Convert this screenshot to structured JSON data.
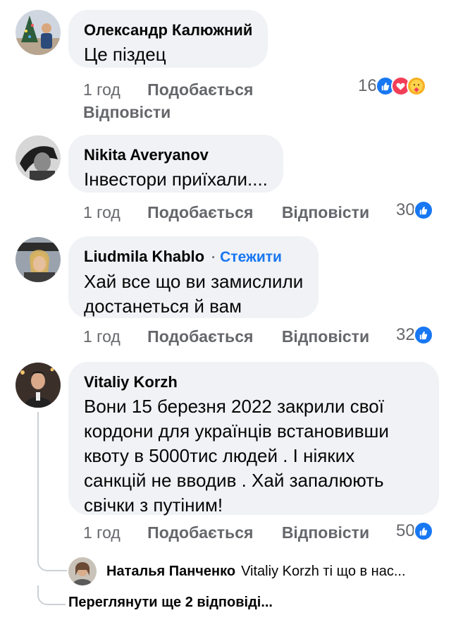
{
  "comments": [
    {
      "author": "Олександр Калюжний",
      "text": "Це піздец",
      "time": "1 год",
      "like_label": "Подобається",
      "reply_label": "Відповісти",
      "reaction_count": "16",
      "reactions": [
        "like-icon",
        "love-icon",
        "care-icon"
      ]
    },
    {
      "author": "Nikita Averyanov",
      "text": "Інвестори приїхали....",
      "time": "1 год",
      "like_label": "Подобається",
      "reply_label": "Відповісти",
      "reaction_count": "30",
      "reactions": [
        "like-icon"
      ]
    },
    {
      "author": "Liudmila Khablo",
      "follow_label": "Стежити",
      "text_lines": [
        "Хай все що ви замислили",
        "достанеться й вам"
      ],
      "time": "1 год",
      "like_label": "Подобається",
      "reply_label": "Відповісти",
      "reaction_count": "32",
      "reactions": [
        "like-icon"
      ]
    },
    {
      "author": "Vitaliy Korzh",
      "text_lines": [
        "Вони 15 березня 2022 закрили свої",
        "кордони для українців встановивши",
        "квоту в 5000тис людей . І ніяких",
        "санкцій не вводив .  Хай запалюють",
        "свічки з путіним!"
      ],
      "time": "1 год",
      "like_label": "Подобається",
      "reply_label": "Відповісти",
      "reaction_count": "50",
      "reactions": [
        "like-icon"
      ]
    }
  ],
  "reply_preview": {
    "author": "Наталья Панченко",
    "text": "Vitaliy Korzh ті що в нас..."
  },
  "more_replies": "Переглянути ще 2 відповіді...",
  "colors": {
    "bubble": "#f0f2f5",
    "secondary_text": "#65676b",
    "link_blue": "#1877f2",
    "like": "#1877f2",
    "love": "#f33e58",
    "care": "#f7b125"
  }
}
